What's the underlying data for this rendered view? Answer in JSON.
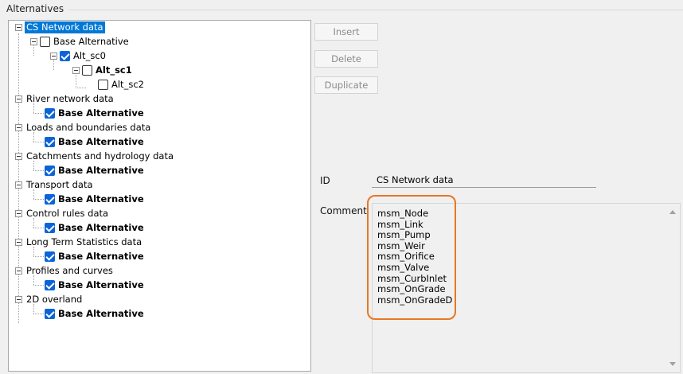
{
  "group": {
    "title": "Alternatives"
  },
  "tree": {
    "cs_network": {
      "label": "CS Network data"
    },
    "base_alt": {
      "label": "Base Alternative"
    },
    "alt_sc0": {
      "label": "Alt_sc0"
    },
    "alt_sc1": {
      "label": "Alt_sc1"
    },
    "alt_sc2": {
      "label": "Alt_sc2"
    },
    "groups": [
      {
        "label": "River network data",
        "child": "Base Alternative"
      },
      {
        "label": "Loads and boundaries data",
        "child": "Base Alternative"
      },
      {
        "label": "Catchments and hydrology data",
        "child": "Base Alternative"
      },
      {
        "label": "Transport data",
        "child": "Base Alternative"
      },
      {
        "label": "Control rules data",
        "child": "Base Alternative"
      },
      {
        "label": "Long Term Statistics data",
        "child": "Base Alternative"
      },
      {
        "label": "Profiles and curves",
        "child": "Base Alternative"
      },
      {
        "label": "2D overland",
        "child": "Base Alternative"
      }
    ]
  },
  "buttons": {
    "insert": "Insert",
    "delete": "Delete",
    "duplicate": "Duplicate"
  },
  "form": {
    "id_label": "ID",
    "id_value": "CS Network data",
    "comment_label": "Comment",
    "comment_lines": [
      "msm_Node",
      "msm_Link",
      "msm_Pump",
      "msm_Weir",
      "msm_Orifice",
      "msm_Valve",
      "msm_CurbInlet",
      "msm_OnGrade",
      "msm_OnGradeD"
    ]
  },
  "colors": {
    "selection": "#0078d7",
    "checkbox": "#0a64d8",
    "highlight": "#e87722"
  },
  "icons": [
    "expand-collapse-icon",
    "checkbox-icon",
    "scroll-up-icon",
    "scroll-down-icon"
  ]
}
